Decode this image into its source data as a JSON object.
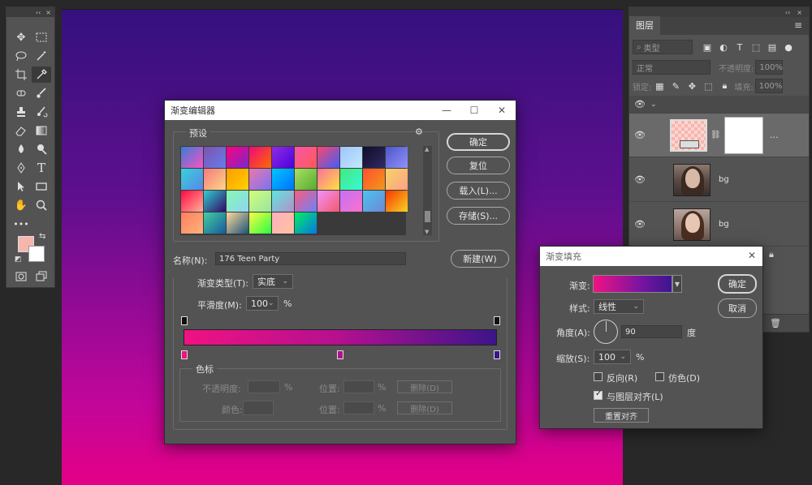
{
  "toolbar": {
    "collapse_label": "‹‹",
    "close_label": "×",
    "colors": {
      "foreground": "#f7b5ae",
      "background": "#ffffff"
    }
  },
  "canvas": {
    "gradient": [
      "#35117e",
      "#e40086"
    ]
  },
  "layers_panel": {
    "tab": "图层",
    "filter_placeholder": "类型",
    "blend_mode": "正常",
    "opacity_label": "不透明度:",
    "opacity_value": "100%",
    "lock_label": "锁定:",
    "fill_label": "填充:",
    "fill_value": "100%",
    "layers": [
      {
        "name": "",
        "type": "gradient-fill-layer"
      },
      {
        "name": "bg",
        "type": "photo"
      },
      {
        "name": "bg",
        "type": "photo"
      }
    ]
  },
  "gradient_editor": {
    "title": "渐变编辑器",
    "presets_label": "预设",
    "buttons": {
      "ok": "确定",
      "reset": "复位",
      "load": "载入(L)...",
      "save": "存储(S)...",
      "new": "新建(W)"
    },
    "name_label": "名称(N):",
    "name_value": "176 Teen Party",
    "gradient_type_label": "渐变类型(T):",
    "gradient_type_value": "实底",
    "smoothness_label": "平滑度(M):",
    "smoothness_value": "100",
    "percent": "%",
    "stops_group_label": "色标",
    "opacity_label": "不透明度:",
    "location_label": "位置:",
    "delete_label": "删除(D)",
    "color_label": "颜色:",
    "gradient_colors": [
      "#f01282",
      "#b3108f",
      "#3c148a"
    ],
    "presets": [
      [
        "#3a7bd5",
        "#f953c6"
      ],
      [
        "#7f53ac",
        "#647dee"
      ],
      [
        "#ff0080",
        "#7928ca"
      ],
      [
        "#ee0979",
        "#ff6a00"
      ],
      [
        "#8e2de2",
        "#4a00e0"
      ],
      [
        "#f857a6",
        "#ff5858"
      ],
      [
        "#fc466b",
        "#3f5efb"
      ],
      [
        "#a1c4fd",
        "#c2e9fb"
      ],
      [
        "#0f0c29",
        "#302b63"
      ],
      [
        "#4e54c8",
        "#8f94fb"
      ],
      [
        "#36d1dc",
        "#5b86e5"
      ],
      [
        "#f7797d",
        "#fbd786"
      ],
      [
        "#ff9a00",
        "#ffd200"
      ],
      [
        "#ec77ab",
        "#7873f5"
      ],
      [
        "#00c6ff",
        "#0072ff"
      ],
      [
        "#a8e063",
        "#56ab2f"
      ],
      [
        "#fa709a",
        "#fee140"
      ],
      [
        "#43e97b",
        "#38f9d7"
      ],
      [
        "#ff512f",
        "#f09819"
      ],
      [
        "#f6d365",
        "#fda085"
      ],
      [
        "#ff0844",
        "#ffb199"
      ],
      [
        "#30cfd0",
        "#330867"
      ],
      [
        "#84fab0",
        "#8fd3f4"
      ],
      [
        "#d4fc79",
        "#96e6a1"
      ],
      [
        "#5ee7df",
        "#b490ca"
      ],
      [
        "#fc5c7d",
        "#6a82fb"
      ],
      [
        "#f093fb",
        "#f5576c"
      ],
      [
        "#c471f5",
        "#fa71cd"
      ],
      [
        "#48c6ef",
        "#6f86d6"
      ],
      [
        "#f83600",
        "#f9d423"
      ],
      [
        "#ff7e5f",
        "#feb47b"
      ],
      [
        "#43cea2",
        "#185a9d"
      ],
      [
        "#ffd89b",
        "#19547b"
      ],
      [
        "#fdfc47",
        "#24fe41"
      ],
      [
        "#ffafbd",
        "#ffc3a0"
      ],
      [
        "#00f260",
        "#0575e6"
      ]
    ]
  },
  "gradient_fill": {
    "title": "渐变填充",
    "gradient_label": "渐变:",
    "style_label": "样式:",
    "style_value": "线性",
    "angle_label": "角度(A):",
    "angle_value": "90",
    "angle_unit": "度",
    "scale_label": "缩放(S):",
    "scale_value": "100",
    "percent": "%",
    "reverse_label": "反向(R)",
    "dither_label": "仿色(D)",
    "align_label": "与图层对齐(L)",
    "reset_align_label": "重置对齐",
    "ok_label": "确定",
    "cancel_label": "取消",
    "reverse_checked": false,
    "dither_checked": false,
    "align_checked": true
  }
}
